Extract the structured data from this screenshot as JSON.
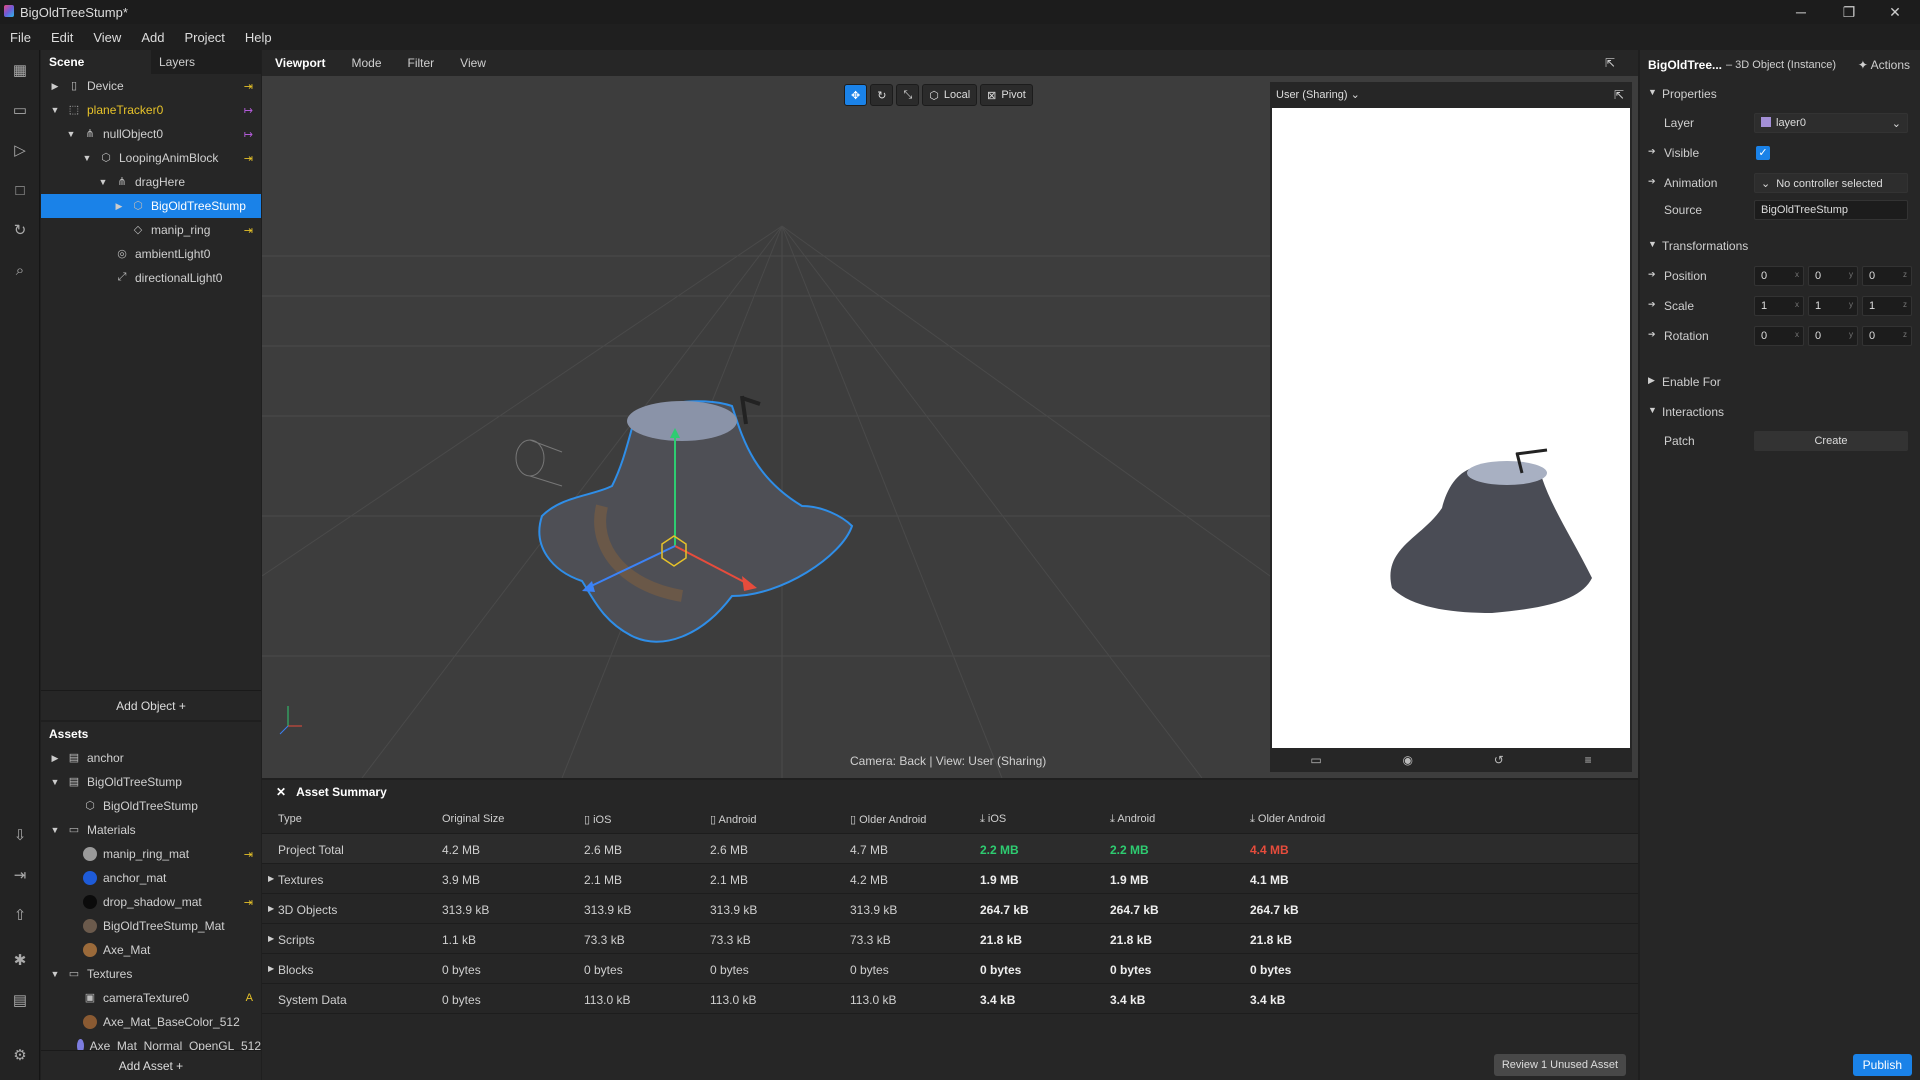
{
  "window": {
    "title": "BigOldTreeStump*",
    "min": "─",
    "restore": "❐",
    "close": "✕"
  },
  "menu": [
    "File",
    "Edit",
    "View",
    "Add",
    "Project",
    "Help"
  ],
  "scene": {
    "tab_scene": "Scene",
    "tab_layers": "Layers",
    "add_object": "Add Object  +",
    "items": [
      {
        "label": "Device",
        "icon": "device-icon",
        "glyph": "▯",
        "arrow": "▶",
        "link": "⇥"
      },
      {
        "label": "planeTracker0",
        "icon": "plane-tracker-icon",
        "glyph": "⬚",
        "arrow": "▼",
        "link": "↦"
      },
      {
        "label": "nullObject0",
        "icon": "null-object-icon",
        "glyph": "⋔",
        "arrow": "▼",
        "link": "↦"
      },
      {
        "label": "LoopingAnimBlock",
        "icon": "block-icon",
        "glyph": "⬡",
        "arrow": "▼",
        "link": "⇥"
      },
      {
        "label": "dragHere",
        "icon": "null-object-icon",
        "glyph": "⋔",
        "arrow": "▼",
        "link": ""
      },
      {
        "label": "BigOldTreeStump",
        "icon": "3d-object-icon",
        "glyph": "⬡",
        "arrow": "▶",
        "link": ""
      },
      {
        "label": "manip_ring",
        "icon": "ring-icon",
        "glyph": "◇",
        "arrow": "",
        "link": "⇥"
      },
      {
        "label": "ambientLight0",
        "icon": "ambient-light-icon",
        "glyph": "◎",
        "arrow": "",
        "link": ""
      },
      {
        "label": "directionalLight0",
        "icon": "directional-light-icon",
        "glyph": "⤢",
        "arrow": "",
        "link": ""
      }
    ]
  },
  "assets": {
    "title": "Assets",
    "add_asset": "Add Asset  +",
    "items": [
      {
        "label": "anchor",
        "arrow": "▶",
        "glyph": "▤",
        "color": ""
      },
      {
        "label": "BigOldTreeStump",
        "arrow": "▼",
        "glyph": "▤",
        "color": ""
      },
      {
        "label": "BigOldTreeStump",
        "arrow": "",
        "glyph": "⬡",
        "color": ""
      },
      {
        "label": "Materials",
        "arrow": "▼",
        "glyph": "▭",
        "color": ""
      },
      {
        "label": "manip_ring_mat",
        "arrow": "",
        "glyph": "",
        "color": "#9a9a9a"
      },
      {
        "label": "anchor_mat",
        "arrow": "",
        "glyph": "",
        "color": "#1e5bd8"
      },
      {
        "label": "drop_shadow_mat",
        "arrow": "",
        "glyph": "",
        "color": "#0b0b0b"
      },
      {
        "label": "BigOldTreeStump_Mat",
        "arrow": "",
        "glyph": "",
        "color": "#6b5a4c"
      },
      {
        "label": "Axe_Mat",
        "arrow": "",
        "glyph": "",
        "color": "#9b6a3a"
      },
      {
        "label": "Textures",
        "arrow": "▼",
        "glyph": "▭",
        "color": ""
      },
      {
        "label": "cameraTexture0",
        "arrow": "",
        "glyph": "▣",
        "color": ""
      },
      {
        "label": "Axe_Mat_BaseColor_512",
        "arrow": "",
        "glyph": "",
        "color": "#8a5a32"
      },
      {
        "label": "Axe_Mat_Normal_OpenGL_512",
        "arrow": "",
        "glyph": "",
        "color": "#7d7de0"
      }
    ]
  },
  "viewport": {
    "tabs": [
      "Viewport",
      "Mode",
      "Filter",
      "View"
    ],
    "local": "Local",
    "pivot": "Pivot",
    "camera_label": "Camera: Back | View: User (Sharing)",
    "preview_title": "User (Sharing)"
  },
  "summary": {
    "title": "Asset Summary",
    "headers": [
      "Type",
      "Original Size",
      "iOS",
      "Android",
      "Older Android",
      "iOS",
      "Android",
      "Older Android"
    ],
    "rows": [
      [
        "Project Total",
        "4.2 MB",
        "2.6 MB",
        "2.6 MB",
        "4.7 MB",
        "2.2 MB",
        "2.2 MB",
        "4.4 MB"
      ],
      [
        "Textures",
        "3.9 MB",
        "2.1 MB",
        "2.1 MB",
        "4.2 MB",
        "1.9 MB",
        "1.9 MB",
        "4.1 MB"
      ],
      [
        "3D Objects",
        "313.9 kB",
        "313.9 kB",
        "313.9 kB",
        "313.9 kB",
        "264.7 kB",
        "264.7 kB",
        "264.7 kB"
      ],
      [
        "Scripts",
        "1.1 kB",
        "73.3 kB",
        "73.3 kB",
        "73.3 kB",
        "21.8 kB",
        "21.8 kB",
        "21.8 kB"
      ],
      [
        "Blocks",
        "0 bytes",
        "0 bytes",
        "0 bytes",
        "0 bytes",
        "0 bytes",
        "0 bytes",
        "0 bytes"
      ],
      [
        "System Data",
        "0 bytes",
        "113.0 kB",
        "113.0 kB",
        "113.0 kB",
        "3.4 kB",
        "3.4 kB",
        "3.4 kB"
      ]
    ],
    "review": "Review 1 Unused Asset"
  },
  "props": {
    "object": "BigOldTree...",
    "type": "– 3D Object (Instance)",
    "actions": "Actions",
    "properties": "Properties",
    "layer_label": "Layer",
    "layer_value": "layer0",
    "visible_label": "Visible",
    "animation_label": "Animation",
    "animation_value": "No controller selected",
    "source_label": "Source",
    "source_value": "BigOldTreeStump",
    "transformations": "Transformations",
    "position": "Position",
    "scale": "Scale",
    "rotation": "Rotation",
    "pos": [
      "0",
      "0",
      "0"
    ],
    "scl": [
      "1",
      "1",
      "1"
    ],
    "rot": [
      "0",
      "0",
      "0"
    ],
    "enable_for": "Enable For",
    "interactions": "Interactions",
    "patch_label": "Patch",
    "create": "Create",
    "publish": "Publish"
  }
}
